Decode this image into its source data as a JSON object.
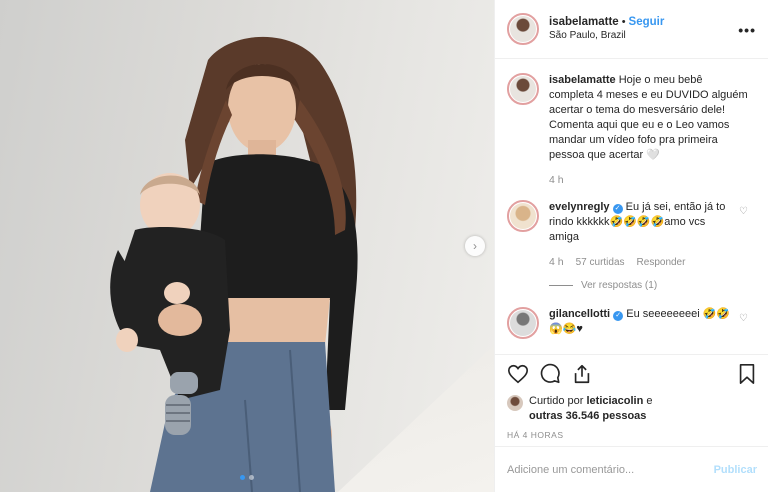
{
  "post": {
    "username": "isabelamatte",
    "follow_label": "Seguir",
    "location": "São Paulo, Brazil",
    "more_icon": "more-horizontal-icon"
  },
  "caption": {
    "username": "isabelamatte",
    "text": "Hoje o meu bebê completa 4 meses e eu DUVIDO alguém acertar o tema do mesversário dele! Comenta aqui que eu e o Leo vamos mandar um vídeo fofo pra primeira pessoa que acertar 🤍",
    "time": "4 h"
  },
  "comments": [
    {
      "username": "evelynregly",
      "verified": true,
      "text": "Eu já sei, então já to rindo kkkkkk🤣🤣🤣🤣amo vcs amiga",
      "time": "4 h",
      "likes": "57 curtidas",
      "reply_label": "Responder",
      "view_replies": "Ver respostas (1)"
    },
    {
      "username": "gilancellotti",
      "verified": true,
      "text": "Eu seeeeeeeei 🤣🤣😱😂♥"
    }
  ],
  "likes": {
    "prefix": "Curtido por",
    "user": "leticiacolin",
    "conjunction": "e",
    "others": "outras 36.546 pessoas"
  },
  "posted_time": "HÁ 4 HORAS",
  "add_comment": {
    "placeholder": "Adicione um comentário...",
    "publish_label": "Publicar"
  },
  "icons": {
    "like": "heart-icon",
    "comment": "comment-icon",
    "share": "share-icon",
    "save": "bookmark-icon",
    "next": "chevron-right-icon"
  },
  "colors": {
    "link_blue": "#3897f0",
    "publish_disabled": "#b2dffc",
    "muted": "#8e8e8e"
  }
}
